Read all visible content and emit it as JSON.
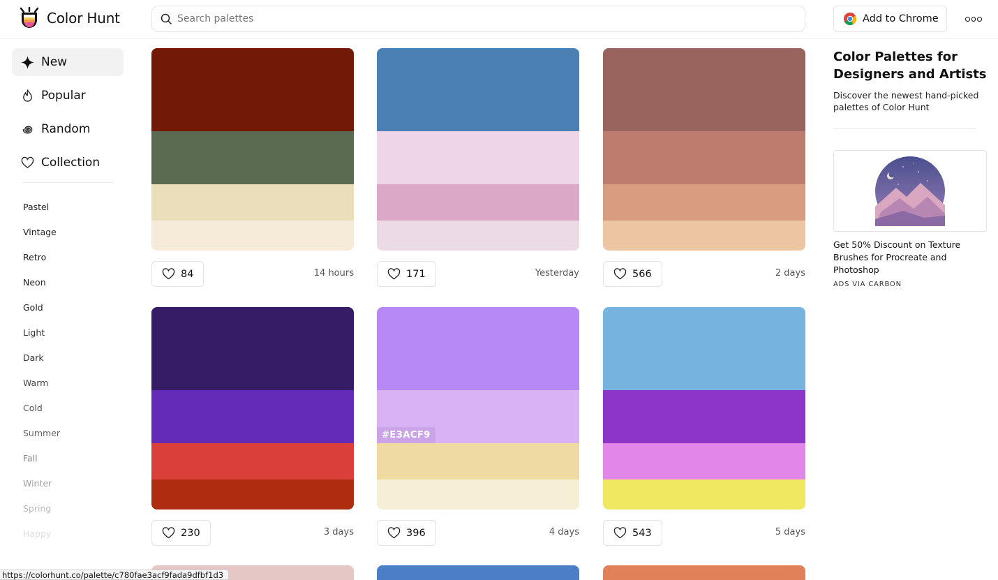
{
  "header": {
    "brand": "Color Hunt",
    "search_placeholder": "Search palettes",
    "chrome_label": "Add to Chrome"
  },
  "sidebar": {
    "nav": [
      {
        "label": "New",
        "icon": "sparkle-icon",
        "active": true
      },
      {
        "label": "Popular",
        "icon": "flame-icon",
        "active": false
      },
      {
        "label": "Random",
        "icon": "spiral-icon",
        "active": false
      },
      {
        "label": "Collection",
        "icon": "heart-icon",
        "active": false
      }
    ],
    "tags": [
      {
        "label": "Pastel",
        "color": "#222222"
      },
      {
        "label": "Vintage",
        "color": "#222222"
      },
      {
        "label": "Retro",
        "color": "#222222"
      },
      {
        "label": "Neon",
        "color": "#222222"
      },
      {
        "label": "Gold",
        "color": "#222222"
      },
      {
        "label": "Light",
        "color": "#333333"
      },
      {
        "label": "Dark",
        "color": "#333333"
      },
      {
        "label": "Warm",
        "color": "#444444"
      },
      {
        "label": "Cold",
        "color": "#555555"
      },
      {
        "label": "Summer",
        "color": "#666666"
      },
      {
        "label": "Fall",
        "color": "#888888"
      },
      {
        "label": "Winter",
        "color": "#a0a0a0"
      },
      {
        "label": "Spring",
        "color": "#bbbbbb"
      },
      {
        "label": "Happy",
        "color": "#dddddd"
      }
    ]
  },
  "palettes": [
    {
      "colors": [
        "#731907",
        "#5b6b51",
        "#ebdfbb",
        "#f6ebd9"
      ],
      "likes": "84",
      "date": "14 hours"
    },
    {
      "colors": [
        "#4a80b4",
        "#efd5e8",
        "#dca8c8",
        "#ecdae6"
      ],
      "likes": "171",
      "date": "Yesterday"
    },
    {
      "colors": [
        "#99645e",
        "#bd7c6e",
        "#da9c80",
        "#ecc6a3"
      ],
      "likes": "566",
      "date": "2 days"
    },
    {
      "colors": [
        "#361c66",
        "#632bb7",
        "#db3f3a",
        "#ae2d10"
      ],
      "likes": "230",
      "date": "3 days"
    },
    {
      "colors": [
        "#b789f7",
        "#d7b3f5",
        "#efdba1",
        "#f6efd5"
      ],
      "likes": "396",
      "date": "4 days",
      "hex_tip": "#E3ACF9"
    },
    {
      "colors": [
        "#76b3df",
        "#8d35c7",
        "#e286ea",
        "#f0e860"
      ],
      "likes": "543",
      "date": "5 days"
    }
  ],
  "next_row_colors": [
    "#e5c7c5",
    "#4a7fc7",
    "#e0815a"
  ],
  "aside": {
    "title": "Color Palettes for Designers and Artists",
    "subtitle": "Discover the newest hand-picked palettes of Color Hunt",
    "ad_text": "Get 50% Discount on Texture Brushes for Procreate and Photoshop",
    "ad_via": "ADS VIA CARBON"
  },
  "status_url": "https://colorhunt.co/palette/c780fae3acf9fada9dfbf1d3"
}
